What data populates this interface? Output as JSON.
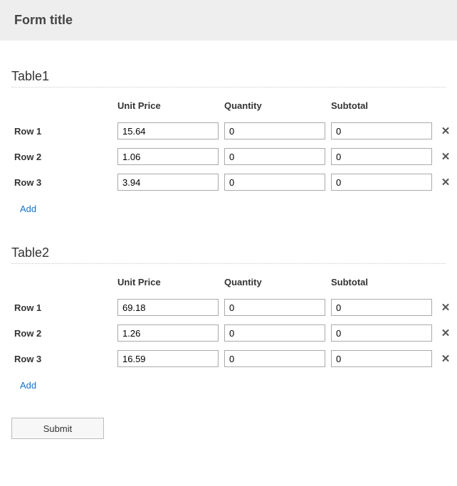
{
  "header": {
    "title": "Form title"
  },
  "columns": {
    "unit_price": "Unit Price",
    "quantity": "Quantity",
    "subtotal": "Subtotal"
  },
  "tables": [
    {
      "title": "Table1",
      "rows": [
        {
          "label": "Row 1",
          "unit_price": "15.64",
          "quantity": "0",
          "subtotal": "0"
        },
        {
          "label": "Row 2",
          "unit_price": "1.06",
          "quantity": "0",
          "subtotal": "0"
        },
        {
          "label": "Row 3",
          "unit_price": "3.94",
          "quantity": "0",
          "subtotal": "0"
        }
      ],
      "add_label": "Add"
    },
    {
      "title": "Table2",
      "rows": [
        {
          "label": "Row 1",
          "unit_price": "69.18",
          "quantity": "0",
          "subtotal": "0"
        },
        {
          "label": "Row 2",
          "unit_price": "1.26",
          "quantity": "0",
          "subtotal": "0"
        },
        {
          "label": "Row 3",
          "unit_price": "16.59",
          "quantity": "0",
          "subtotal": "0"
        }
      ],
      "add_label": "Add"
    }
  ],
  "submit_label": "Submit"
}
